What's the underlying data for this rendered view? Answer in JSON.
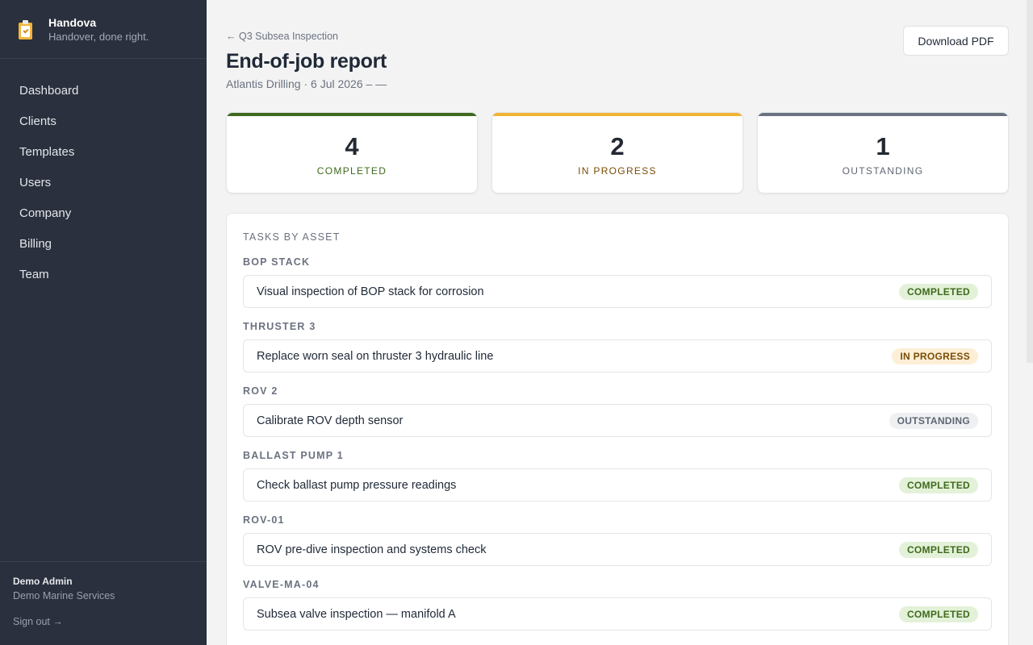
{
  "brand": {
    "name": "Handova",
    "tagline": "Handover, done right."
  },
  "nav": [
    {
      "label": "Dashboard"
    },
    {
      "label": "Clients"
    },
    {
      "label": "Templates"
    },
    {
      "label": "Users"
    },
    {
      "label": "Company"
    },
    {
      "label": "Billing"
    },
    {
      "label": "Team"
    }
  ],
  "user": {
    "name": "Demo Admin",
    "org": "Demo Marine Services",
    "signout": "Sign out →"
  },
  "page": {
    "back_link": "← Q3 Subsea Inspection",
    "title": "End-of-job report",
    "subtitle": "Atlantis Drilling · 6 Jul 2026 – —",
    "download_label": "Download PDF"
  },
  "stats": [
    {
      "value": "4",
      "label": "COMPLETED",
      "color": "#3f6a1c",
      "bar": "#3f6a1c"
    },
    {
      "value": "2",
      "label": "IN PROGRESS",
      "color": "#7a4d06",
      "bar": "#f2b233"
    },
    {
      "value": "1",
      "label": "OUTSTANDING",
      "color": "#5e6673",
      "bar": "#6b7280"
    }
  ],
  "tasks": {
    "heading": "TASKS BY ASSET",
    "groups": [
      {
        "asset": "BOP STACK",
        "title": "Visual inspection of BOP stack for corrosion",
        "status": "COMPLETED",
        "kind": "completed"
      },
      {
        "asset": "THRUSTER 3",
        "title": "Replace worn seal on thruster 3 hydraulic line",
        "status": "IN PROGRESS",
        "kind": "inprogress"
      },
      {
        "asset": "ROV 2",
        "title": "Calibrate ROV depth sensor",
        "status": "OUTSTANDING",
        "kind": "outstanding"
      },
      {
        "asset": "BALLAST PUMP 1",
        "title": "Check ballast pump pressure readings",
        "status": "COMPLETED",
        "kind": "completed"
      },
      {
        "asset": "ROV-01",
        "title": "ROV pre-dive inspection and systems check",
        "status": "COMPLETED",
        "kind": "completed"
      },
      {
        "asset": "VALVE-MA-04",
        "title": "Subsea valve inspection — manifold A",
        "status": "COMPLETED",
        "kind": "completed"
      }
    ]
  }
}
